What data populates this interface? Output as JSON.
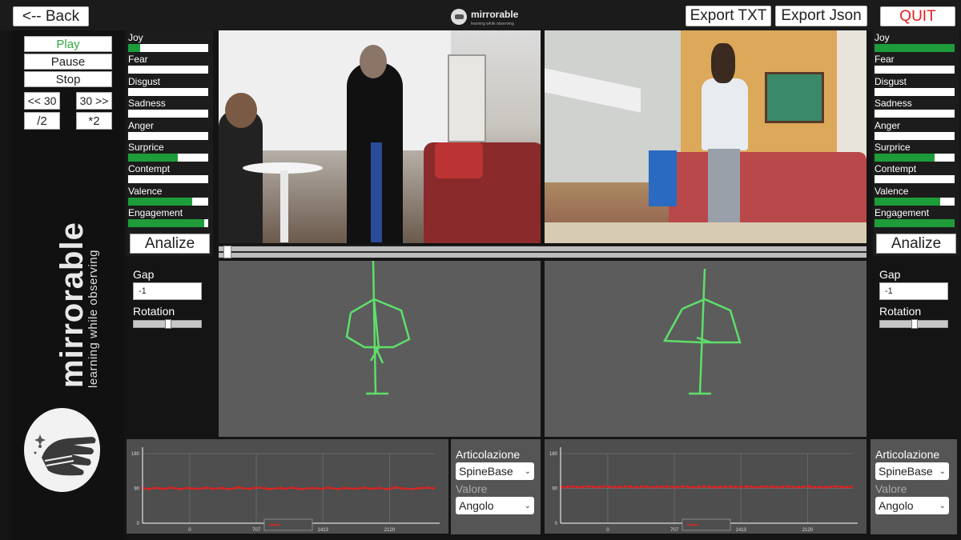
{
  "topbar": {
    "back_label": "<-- Back",
    "export_txt_label": "Export TXT",
    "export_json_label": "Export Json",
    "quit_label": "QUIT",
    "logo_text": "mirrorable",
    "logo_sub": "learning while observing"
  },
  "playback": {
    "play": "Play",
    "pause": "Pause",
    "stop": "Stop",
    "rewind": "<< 30",
    "forward": "30 >>",
    "half": "/2",
    "double": "*2"
  },
  "brand": {
    "name": "mirrorable",
    "tagline": "learning while observing"
  },
  "emotions_left": [
    {
      "label": "Joy",
      "level": 0.15
    },
    {
      "label": "Fear",
      "level": 0
    },
    {
      "label": "Disgust",
      "level": 0
    },
    {
      "label": "Sadness",
      "level": 0
    },
    {
      "label": "Anger",
      "level": 0
    },
    {
      "label": "Surprice",
      "level": 0.62
    },
    {
      "label": "Contempt",
      "level": 0
    },
    {
      "label": "Valence",
      "level": 0.8
    },
    {
      "label": "Engagement",
      "level": 0.95
    }
  ],
  "emotions_right": [
    {
      "label": "Joy",
      "level": 1.0
    },
    {
      "label": "Fear",
      "level": 0
    },
    {
      "label": "Disgust",
      "level": 0
    },
    {
      "label": "Sadness",
      "level": 0
    },
    {
      "label": "Anger",
      "level": 0
    },
    {
      "label": "Surprice",
      "level": 0.75
    },
    {
      "label": "Contempt",
      "level": 0
    },
    {
      "label": "Valence",
      "level": 0.82
    },
    {
      "label": "Engagement",
      "level": 1.0
    }
  ],
  "analize_label": "Analize",
  "gap_left": {
    "gap_label": "Gap",
    "gap_value": "-1",
    "rotation_label": "Rotation",
    "rotation_level": 0.5
  },
  "gap_right": {
    "gap_label": "Gap",
    "gap_value": "-1",
    "rotation_label": "Rotation",
    "rotation_level": 0.5
  },
  "selector_left": {
    "title": "Articolazione",
    "joint": "SpineBase",
    "sub": "Valore",
    "value": "Angolo"
  },
  "selector_right": {
    "title": "Articolazione",
    "joint": "SpineBase",
    "sub": "Valore",
    "value": "Angolo"
  },
  "colors": {
    "accent_green": "#1e9c3a",
    "skeleton_green": "#5ee06a",
    "series_red": "#e02020",
    "quit_red": "#e02020"
  },
  "chart_data": [
    {
      "type": "line",
      "ylim": [
        0,
        180
      ],
      "yticks": [
        "0",
        "90",
        "180"
      ],
      "xticks": [
        "0",
        "707",
        "1413",
        "2120"
      ],
      "xlim": [
        -500,
        2600
      ],
      "legend": "top-bottom-center",
      "series": [
        {
          "name": "",
          "y_values": [
            90,
            88,
            91,
            90,
            89,
            92,
            90,
            88,
            91,
            90,
            89,
            90,
            92,
            89,
            90,
            91,
            88,
            90,
            93,
            90,
            89,
            91,
            92,
            90,
            88,
            90,
            91,
            89,
            92,
            90,
            88,
            90,
            91,
            90,
            89,
            92,
            90,
            88,
            91,
            90,
            89,
            90,
            92,
            89,
            90,
            91,
            88,
            90,
            93,
            90,
            89,
            88,
            90,
            91,
            92,
            90
          ]
        }
      ]
    },
    {
      "type": "line",
      "ylim": [
        0,
        180
      ],
      "yticks": [
        "0",
        "90",
        "180"
      ],
      "xticks": [
        "0",
        "707",
        "1413",
        "2120"
      ],
      "xlim": [
        -500,
        2600
      ],
      "legend": "top-bottom-center",
      "series": [
        {
          "name": "",
          "y_values": [
            93,
            94,
            95,
            93,
            94,
            95,
            94,
            93,
            95,
            94,
            93,
            94,
            95,
            94,
            93,
            94,
            95,
            93,
            94,
            94,
            95,
            93,
            94,
            95,
            94,
            93,
            94,
            95,
            94,
            93,
            94,
            94,
            95,
            93,
            94,
            95,
            94,
            93,
            94,
            95,
            94,
            93,
            94,
            95,
            93,
            94,
            94,
            95,
            93,
            94,
            93,
            94,
            95,
            94,
            93,
            94
          ]
        }
      ]
    }
  ]
}
